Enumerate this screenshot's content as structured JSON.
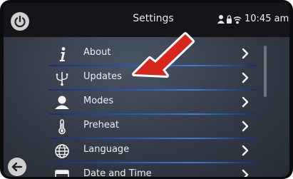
{
  "header": {
    "title": "Settings",
    "time": "10:45 am",
    "status_icons": [
      "person-icon",
      "lock-icon",
      "wifi-icon"
    ]
  },
  "menu": {
    "items": [
      {
        "label": "About",
        "icon": "info-icon"
      },
      {
        "label": "Updates",
        "icon": "usb-icon"
      },
      {
        "label": "Modes",
        "icon": "chef-hat-icon"
      },
      {
        "label": "Preheat",
        "icon": "thermometer-icon"
      },
      {
        "label": "Language",
        "icon": "globe-icon"
      },
      {
        "label": "Date and Time",
        "icon": "calendar-icon"
      }
    ]
  },
  "colors": {
    "separator": "#2a56c0",
    "callout_arrow": "#d7261e",
    "background": "#323a45"
  }
}
